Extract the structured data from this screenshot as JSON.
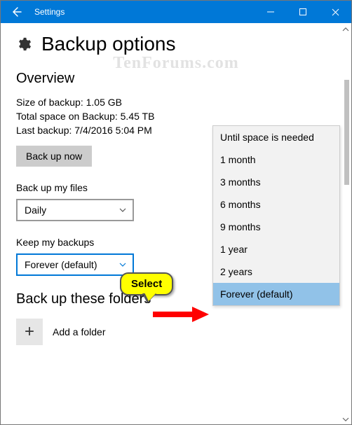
{
  "window": {
    "title": "Settings"
  },
  "header": {
    "title": "Backup options"
  },
  "watermark": "TenForums.com",
  "overview": {
    "heading": "Overview",
    "size_line": "Size of backup: 1.05 GB",
    "space_line": "Total space on Backup: 5.45 TB",
    "last_line": "Last backup: 7/4/2016 5:04 PM",
    "backup_now": "Back up now"
  },
  "frequency": {
    "label": "Back up my files",
    "value": "Daily"
  },
  "retention": {
    "label": "Keep my backups",
    "value": "Forever (default)",
    "options": [
      "Until space is needed",
      "1 month",
      "3 months",
      "6 months",
      "9 months",
      "1 year",
      "2 years",
      "Forever (default)"
    ]
  },
  "folders": {
    "heading": "Back up these folders",
    "add_label": "Add a folder"
  },
  "callout": {
    "text": "Select"
  }
}
